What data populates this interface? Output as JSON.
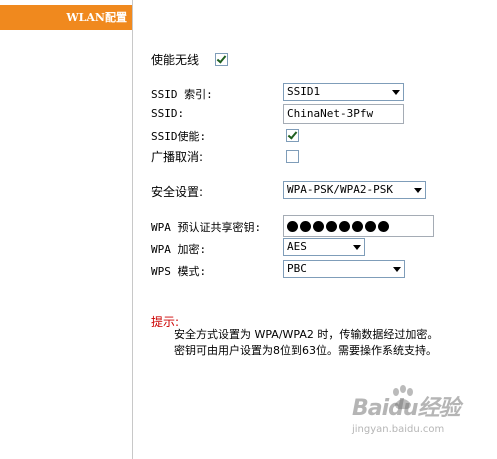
{
  "sidebar": {
    "tab_label": "WLAN配置",
    "accent_color": "#f0891e"
  },
  "wireless": {
    "enable_label": "使能无线",
    "enable_checked": true
  },
  "ssid_index": {
    "label": "SSID 索引:",
    "selected": "SSID1"
  },
  "ssid": {
    "label": "SSID:",
    "value": "ChinaNet-3Pfw"
  },
  "ssid_enable": {
    "label": "SSID使能:",
    "checked": true
  },
  "broadcast_cancel": {
    "label": "广播取消:",
    "checked": false
  },
  "security": {
    "label": "安全设置:",
    "selected": "WPA-PSK/WPA2-PSK"
  },
  "wpa_psk": {
    "label": "WPA 预认证共享密钥:",
    "masked_length": 8
  },
  "wpa_encryption": {
    "label": "WPA 加密:",
    "selected": "AES"
  },
  "wps_mode": {
    "label": "WPS 模式:",
    "selected": "PBC"
  },
  "hint": {
    "title": "提示:",
    "line1": "安全方式设置为 WPA/WPA2 时，传输数据经过加密。",
    "line2": "密钥可由用户设置为8位到63位。需要操作系统支持。",
    "title_color": "#cc0000"
  },
  "watermark": {
    "brand": "Baidu经验",
    "url": "jingyan.baidu.com"
  }
}
